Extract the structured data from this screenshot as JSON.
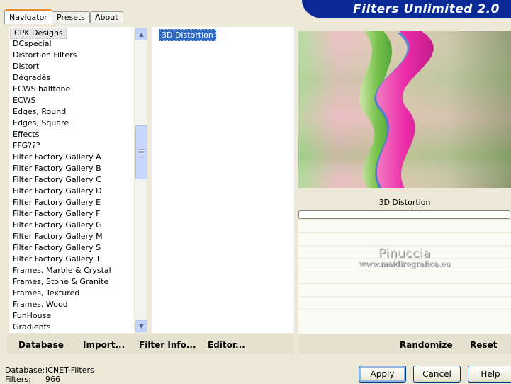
{
  "tabs": [
    "Navigator",
    "Presets",
    "About"
  ],
  "banner": "Filters Unlimited 2.0",
  "categories": [
    "CPK Designs",
    "DCspecial",
    "Distortion Filters",
    "Distort",
    "Dégradés",
    "ECWS halftone",
    "ECWS",
    "Edges, Round",
    "Edges, Square",
    "Effects",
    "FFG???",
    "Filter Factory Gallery A",
    "Filter Factory Gallery B",
    "Filter Factory Gallery C",
    "Filter Factory Gallery D",
    "Filter Factory Gallery E",
    "Filter Factory Gallery F",
    "Filter Factory Gallery G",
    "Filter Factory Gallery M",
    "Filter Factory Gallery S",
    "Filter Factory Gallery T",
    "Frames, Marble & Crystal",
    "Frames, Stone & Granite",
    "Frames, Textured",
    "Frames, Wood",
    "FunHouse",
    "Gradients"
  ],
  "selected_category": "CPK Designs",
  "filters": [
    "3D Distortion"
  ],
  "left_buttons": {
    "database": "Database",
    "import": "Import...",
    "filter_info": "Filter Info...",
    "editor": "Editor..."
  },
  "filter_name": "3D Distortion",
  "watermark": {
    "line1": "Pinuccia",
    "line2": "www.maidiregrafica.eu"
  },
  "right_buttons": {
    "randomize": "Randomize",
    "reset": "Reset"
  },
  "status": {
    "db_label": "Database:",
    "db_value": "ICNET-Filters",
    "filters_label": "Filters:",
    "filters_value": "966"
  },
  "dialog_buttons": {
    "apply": "Apply",
    "cancel": "Cancel",
    "help": "Help"
  }
}
